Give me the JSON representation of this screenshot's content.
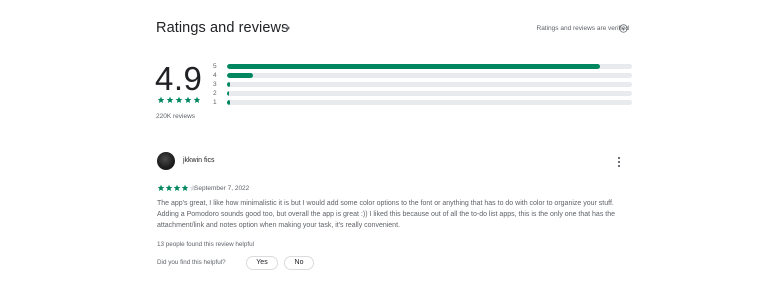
{
  "header": {
    "title": "Ratings and reviews",
    "verified_note": "Ratings and reviews are verified"
  },
  "summary": {
    "score": "4.9",
    "stars_rating": 4.9,
    "total_reviews": "220K reviews"
  },
  "histogram": [
    {
      "label": "5",
      "fraction": 0.92
    },
    {
      "label": "4",
      "fraction": 0.065
    },
    {
      "label": "3",
      "fraction": 0.008
    },
    {
      "label": "2",
      "fraction": 0.003
    },
    {
      "label": "1",
      "fraction": 0.008
    }
  ],
  "review": {
    "author": "jkkwin fics",
    "stars": 4,
    "date": "September 7, 2022",
    "text": "The app's great, I like how minimalistic it is but I would add some color options to the font or anything that has to do with color to organize your stuff. Adding a Pomodoro sounds good too, but overall the app is great :)) I liked this because out of all the to-do list apps, this is the only one that has the attachment/link and notes option when making your task, it's really convenient.",
    "helpful_count": "13 people found this review helpful",
    "helpful_question": "Did you find this helpful?",
    "yes_label": "Yes",
    "no_label": "No"
  },
  "colors": {
    "accent": "#01875f",
    "track": "#e8eaed",
    "text_primary": "#202124",
    "text_secondary": "#5f6368"
  },
  "icons": {
    "header_arrow": "arrow-right-icon",
    "info": "info-icon",
    "menu": "more-vert-icon",
    "star": "star-icon"
  }
}
